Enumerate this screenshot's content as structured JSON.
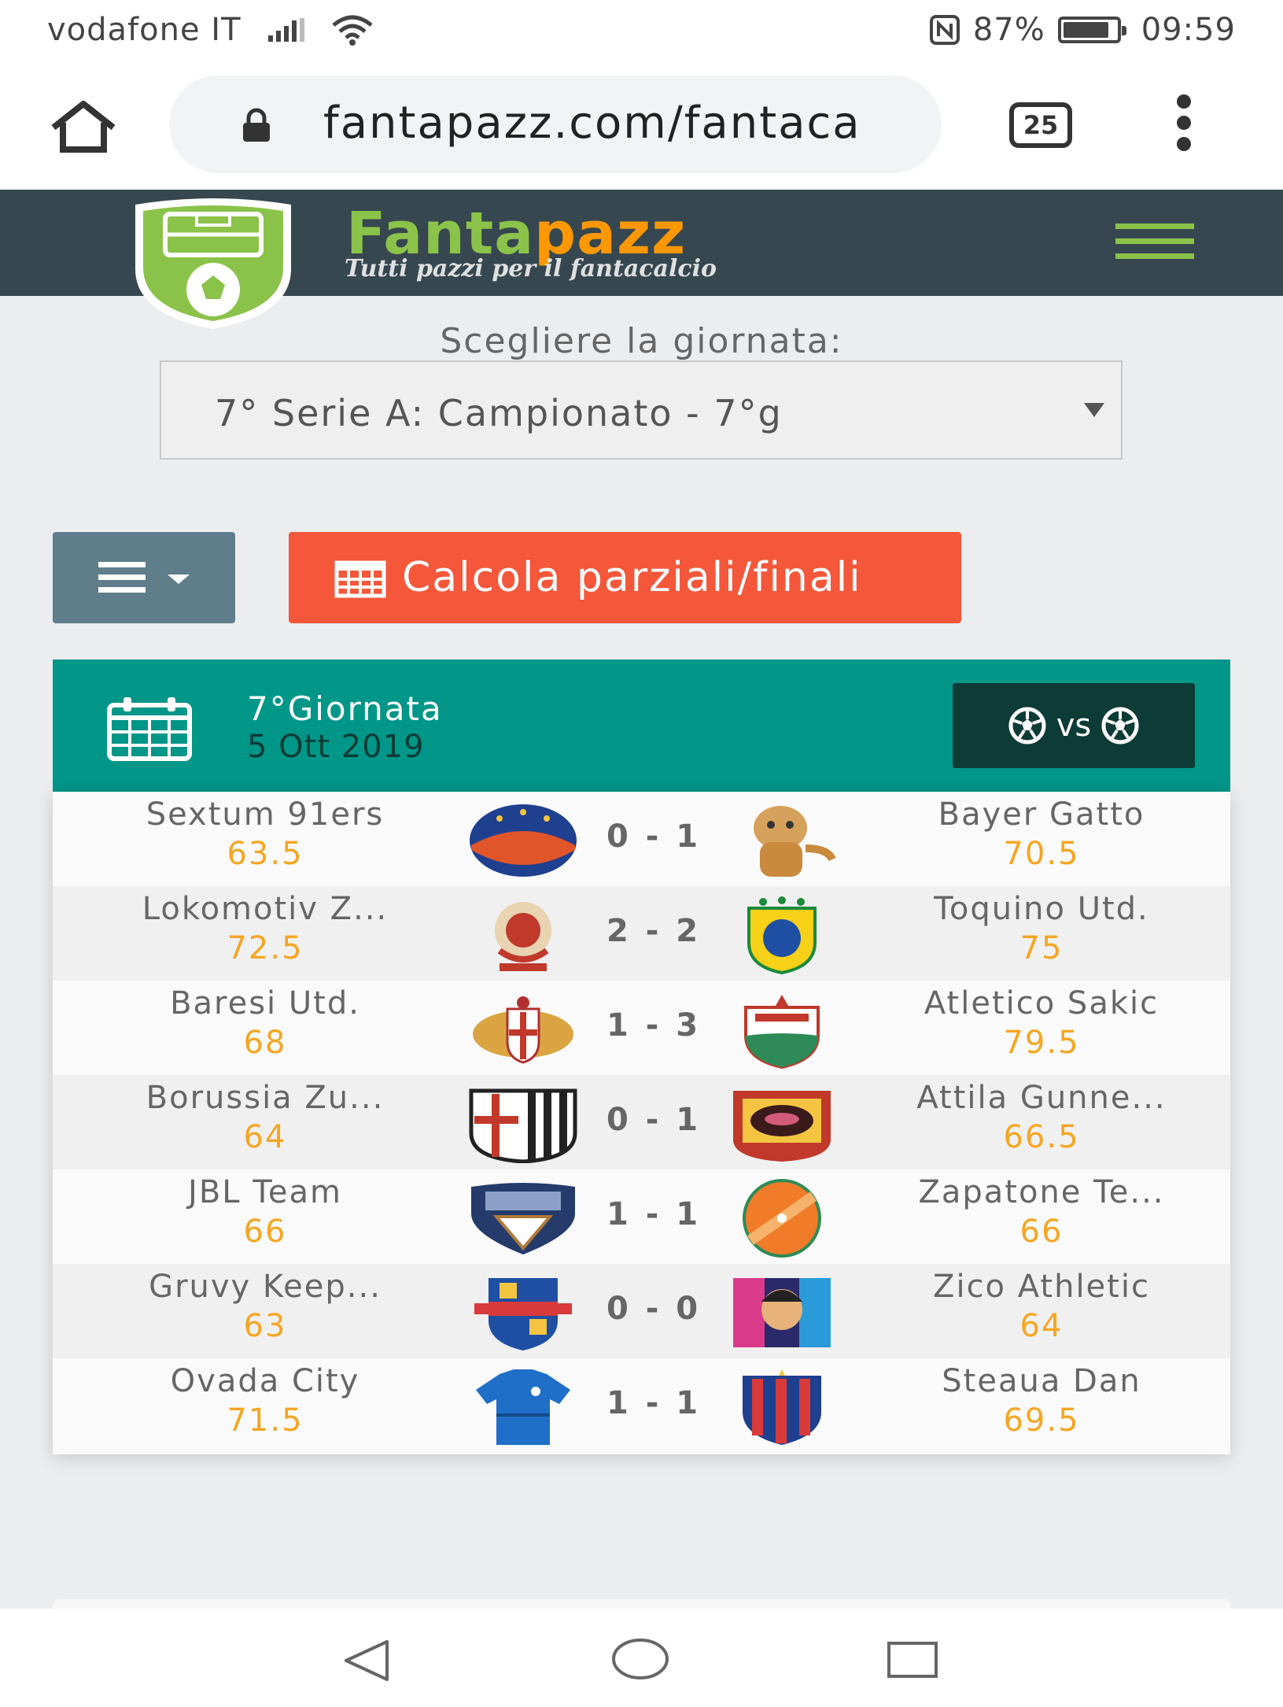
{
  "status_bar": {
    "carrier": "vodafone IT",
    "battery_percent": "87%",
    "time": "09:59",
    "battery_level": 0.87
  },
  "browser": {
    "url": "fantapazz.com/fantaca",
    "tab_count": "25"
  },
  "site": {
    "brand_part1": "Fanta",
    "brand_part2": "pazz",
    "tagline": "Tutti pazzi per il fantacalcio",
    "accent_green": "#8bc34a",
    "accent_orange": "#ff9800"
  },
  "round_selector": {
    "label": "Scegliere la giornata:",
    "selected": "7° Serie A: Campionato - 7°g"
  },
  "actions": {
    "calculate_label": "Calcola parziali/finali",
    "calculate_color": "#f4573a",
    "menu_color": "#607d8b"
  },
  "round": {
    "title": "7°Giornata",
    "date": "5 Ott 2019",
    "vs_label": "vs",
    "header_color": "#009688"
  },
  "matches": [
    {
      "home": "Sextum 91ers",
      "home_points": "63.5",
      "score": "0 - 1",
      "away": "Bayer Gatto",
      "away_points": "70.5"
    },
    {
      "home": "Lokomotiv Z...",
      "home_points": "72.5",
      "score": "2 - 2",
      "away": "Toquino Utd.",
      "away_points": "75"
    },
    {
      "home": "Baresi Utd.",
      "home_points": "68",
      "score": "1 - 3",
      "away": "Atletico Sakic",
      "away_points": "79.5"
    },
    {
      "home": "Borussia Zu...",
      "home_points": "64",
      "score": "0 - 1",
      "away": "Attila Gunne...",
      "away_points": "66.5"
    },
    {
      "home": "JBL Team",
      "home_points": "66",
      "score": "1 - 1",
      "away": "Zapatone Te...",
      "away_points": "66"
    },
    {
      "home": "Gruvy Keep...",
      "home_points": "63",
      "score": "0 - 0",
      "away": "Zico Athletic",
      "away_points": "64"
    },
    {
      "home": "Ovada City",
      "home_points": "71.5",
      "score": "1 - 1",
      "away": "Steaua Dan",
      "away_points": "69.5"
    }
  ],
  "crest_icons": {
    "home": [
      "sextum-crest-icon",
      "lokomotiv-crest-icon",
      "baresi-crest-icon",
      "borussia-crest-icon",
      "jbl-crest-icon",
      "gruvy-crest-icon",
      "ovada-crest-icon"
    ],
    "away": [
      "bayer-gatto-crest-icon",
      "toquino-crest-icon",
      "atletico-sakic-crest-icon",
      "attila-crest-icon",
      "zapatone-crest-icon",
      "zico-crest-icon",
      "steaua-crest-icon"
    ]
  }
}
